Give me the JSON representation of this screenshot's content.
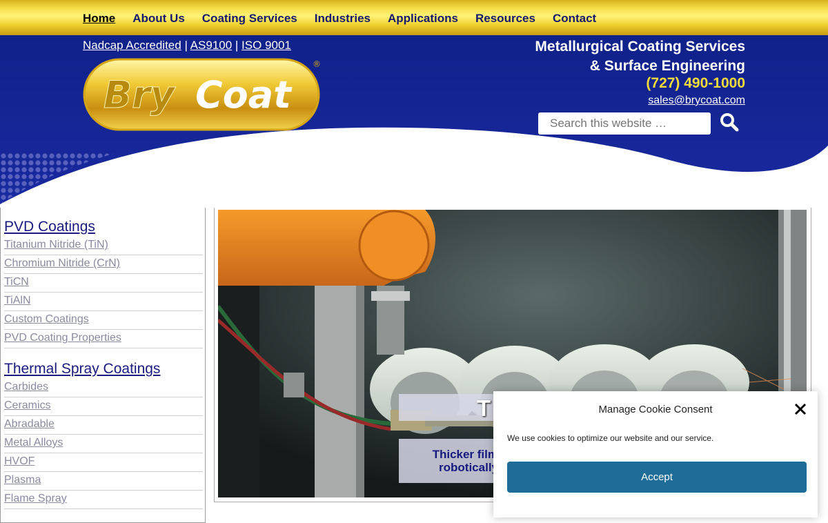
{
  "nav": {
    "items": [
      "Home",
      "About Us",
      "Coating Services",
      "Industries",
      "Applications",
      "Resources",
      "Contact"
    ]
  },
  "header": {
    "certs": [
      "Nadcap Accredited",
      "AS9100",
      "ISO 9001"
    ],
    "separator": "|",
    "logo_text": {
      "part1": "Bry",
      "part2": "Coat",
      "mark": "®"
    },
    "tagline_line1": "Metallurgical Coating Services",
    "tagline_line2": "& Surface Engineering",
    "phone": "(727) 490-1000",
    "email": "sales@brycoat.com",
    "search_placeholder": "Search this website …",
    "search_icon": "magnifier-icon"
  },
  "sidebar": {
    "sections": [
      {
        "heading": "PVD Coatings",
        "items": [
          "Titanium Nitride (TiN)",
          "Chromium Nitride (CrN)",
          "TiCN",
          "TiAlN",
          "Custom Coatings",
          "PVD Coating Properties"
        ]
      },
      {
        "heading": "Thermal Spray Coatings",
        "items": [
          "Carbides",
          "Ceramics",
          "Abradable",
          "Metal Alloys",
          "HVOF",
          "Plasma",
          "Flame Spray"
        ]
      }
    ]
  },
  "slider": {
    "title_visible": "T",
    "caption_line1": "Thicker film",
    "caption_line2": "robotically"
  },
  "cookie": {
    "title": "Manage Cookie Consent",
    "text": "We use cookies to optimize our website and our service.",
    "accept_label": "Accept",
    "close_icon": "close-icon"
  },
  "colors": {
    "nav_gold": "#f6e04a",
    "header_blue": "#13238c",
    "phone_yellow": "#f7dc3a",
    "accept_blue": "#1e6c98"
  }
}
